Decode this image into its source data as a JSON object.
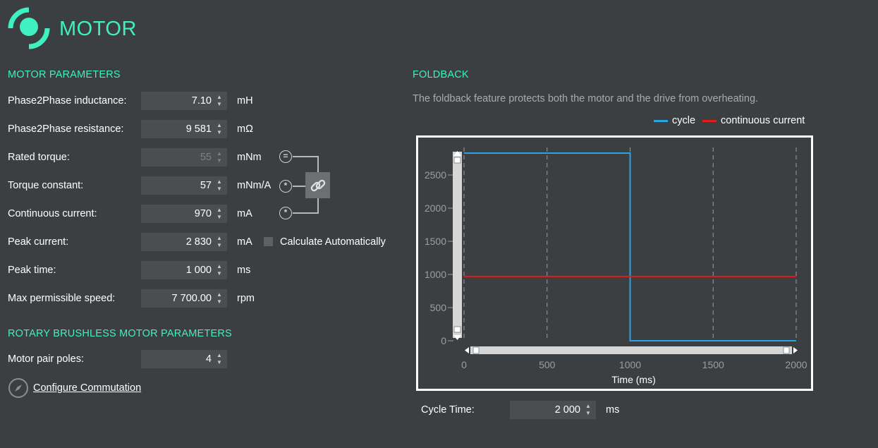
{
  "app": {
    "title": "MOTOR"
  },
  "motor_parameters": {
    "title": "MOTOR PARAMETERS",
    "rows": [
      {
        "label": "Phase2Phase inductance:",
        "value": "7.10",
        "unit": "mH"
      },
      {
        "label": "Phase2Phase resistance:",
        "value": "9 581",
        "unit": "mΩ"
      },
      {
        "label": "Rated torque:",
        "value": "55",
        "unit": "mNm"
      },
      {
        "label": "Torque constant:",
        "value": "57",
        "unit": "mNm/A"
      },
      {
        "label": "Continuous current:",
        "value": "970",
        "unit": "mA"
      },
      {
        "label": "Peak current:",
        "value": "2 830",
        "unit": "mA"
      },
      {
        "label": "Peak time:",
        "value": "1 000",
        "unit": "ms"
      },
      {
        "label": "Max permissible speed:",
        "value": "7 700.00",
        "unit": "rpm"
      }
    ],
    "calculate_automatically": {
      "label": "Calculate Automatically",
      "checked": false
    },
    "relation_icons": {
      "equals": "=",
      "multiply": "*"
    }
  },
  "rotary": {
    "title": "ROTARY BRUSHLESS MOTOR PARAMETERS",
    "pair_poles": {
      "label": "Motor pair poles:",
      "value": "4"
    },
    "configure_link": "Configure Commutation"
  },
  "foldback": {
    "title": "FOLDBACK",
    "description": "The foldback feature protects both the motor and the drive from overheating.",
    "cycle_time": {
      "label": "Cycle Time:",
      "value": "2 000",
      "unit": "ms"
    }
  },
  "chart_data": {
    "type": "line",
    "xlabel": "Time (ms)",
    "ylabel": "",
    "xlim": [
      0,
      2000
    ],
    "ylim": [
      0,
      2830
    ],
    "x_ticks": [
      0,
      500,
      1000,
      1500,
      2000
    ],
    "y_ticks": [
      0,
      500,
      1000,
      1500,
      2000,
      2500
    ],
    "grid": "vertical dashed",
    "legend_position": "top-right",
    "series": [
      {
        "name": "cycle",
        "color": "#2aa3e0",
        "x": [
          0,
          1000,
          1000,
          2000
        ],
        "y": [
          2830,
          2830,
          0,
          0
        ]
      },
      {
        "name": "continuous current",
        "color": "#e21b1b",
        "x": [
          0,
          2000
        ],
        "y": [
          970,
          970
        ]
      }
    ]
  },
  "colors": {
    "accent": "#3ff0c0",
    "background": "#3b3f42",
    "field": "#4a4e51"
  }
}
